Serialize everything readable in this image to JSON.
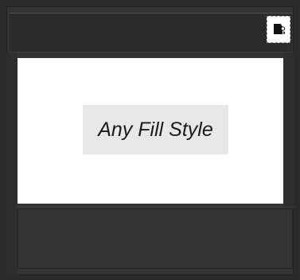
{
  "toolbar": {
    "fill_style_icon": "fill-bucket-icon"
  },
  "preview": {
    "label": "Any Fill Style"
  },
  "colors": {
    "background": "#2a2a2a",
    "panel": "#343434",
    "preview_bg": "#ffffff",
    "label_bg": "#e8e8e8",
    "label_text": "#1a1a1a"
  }
}
